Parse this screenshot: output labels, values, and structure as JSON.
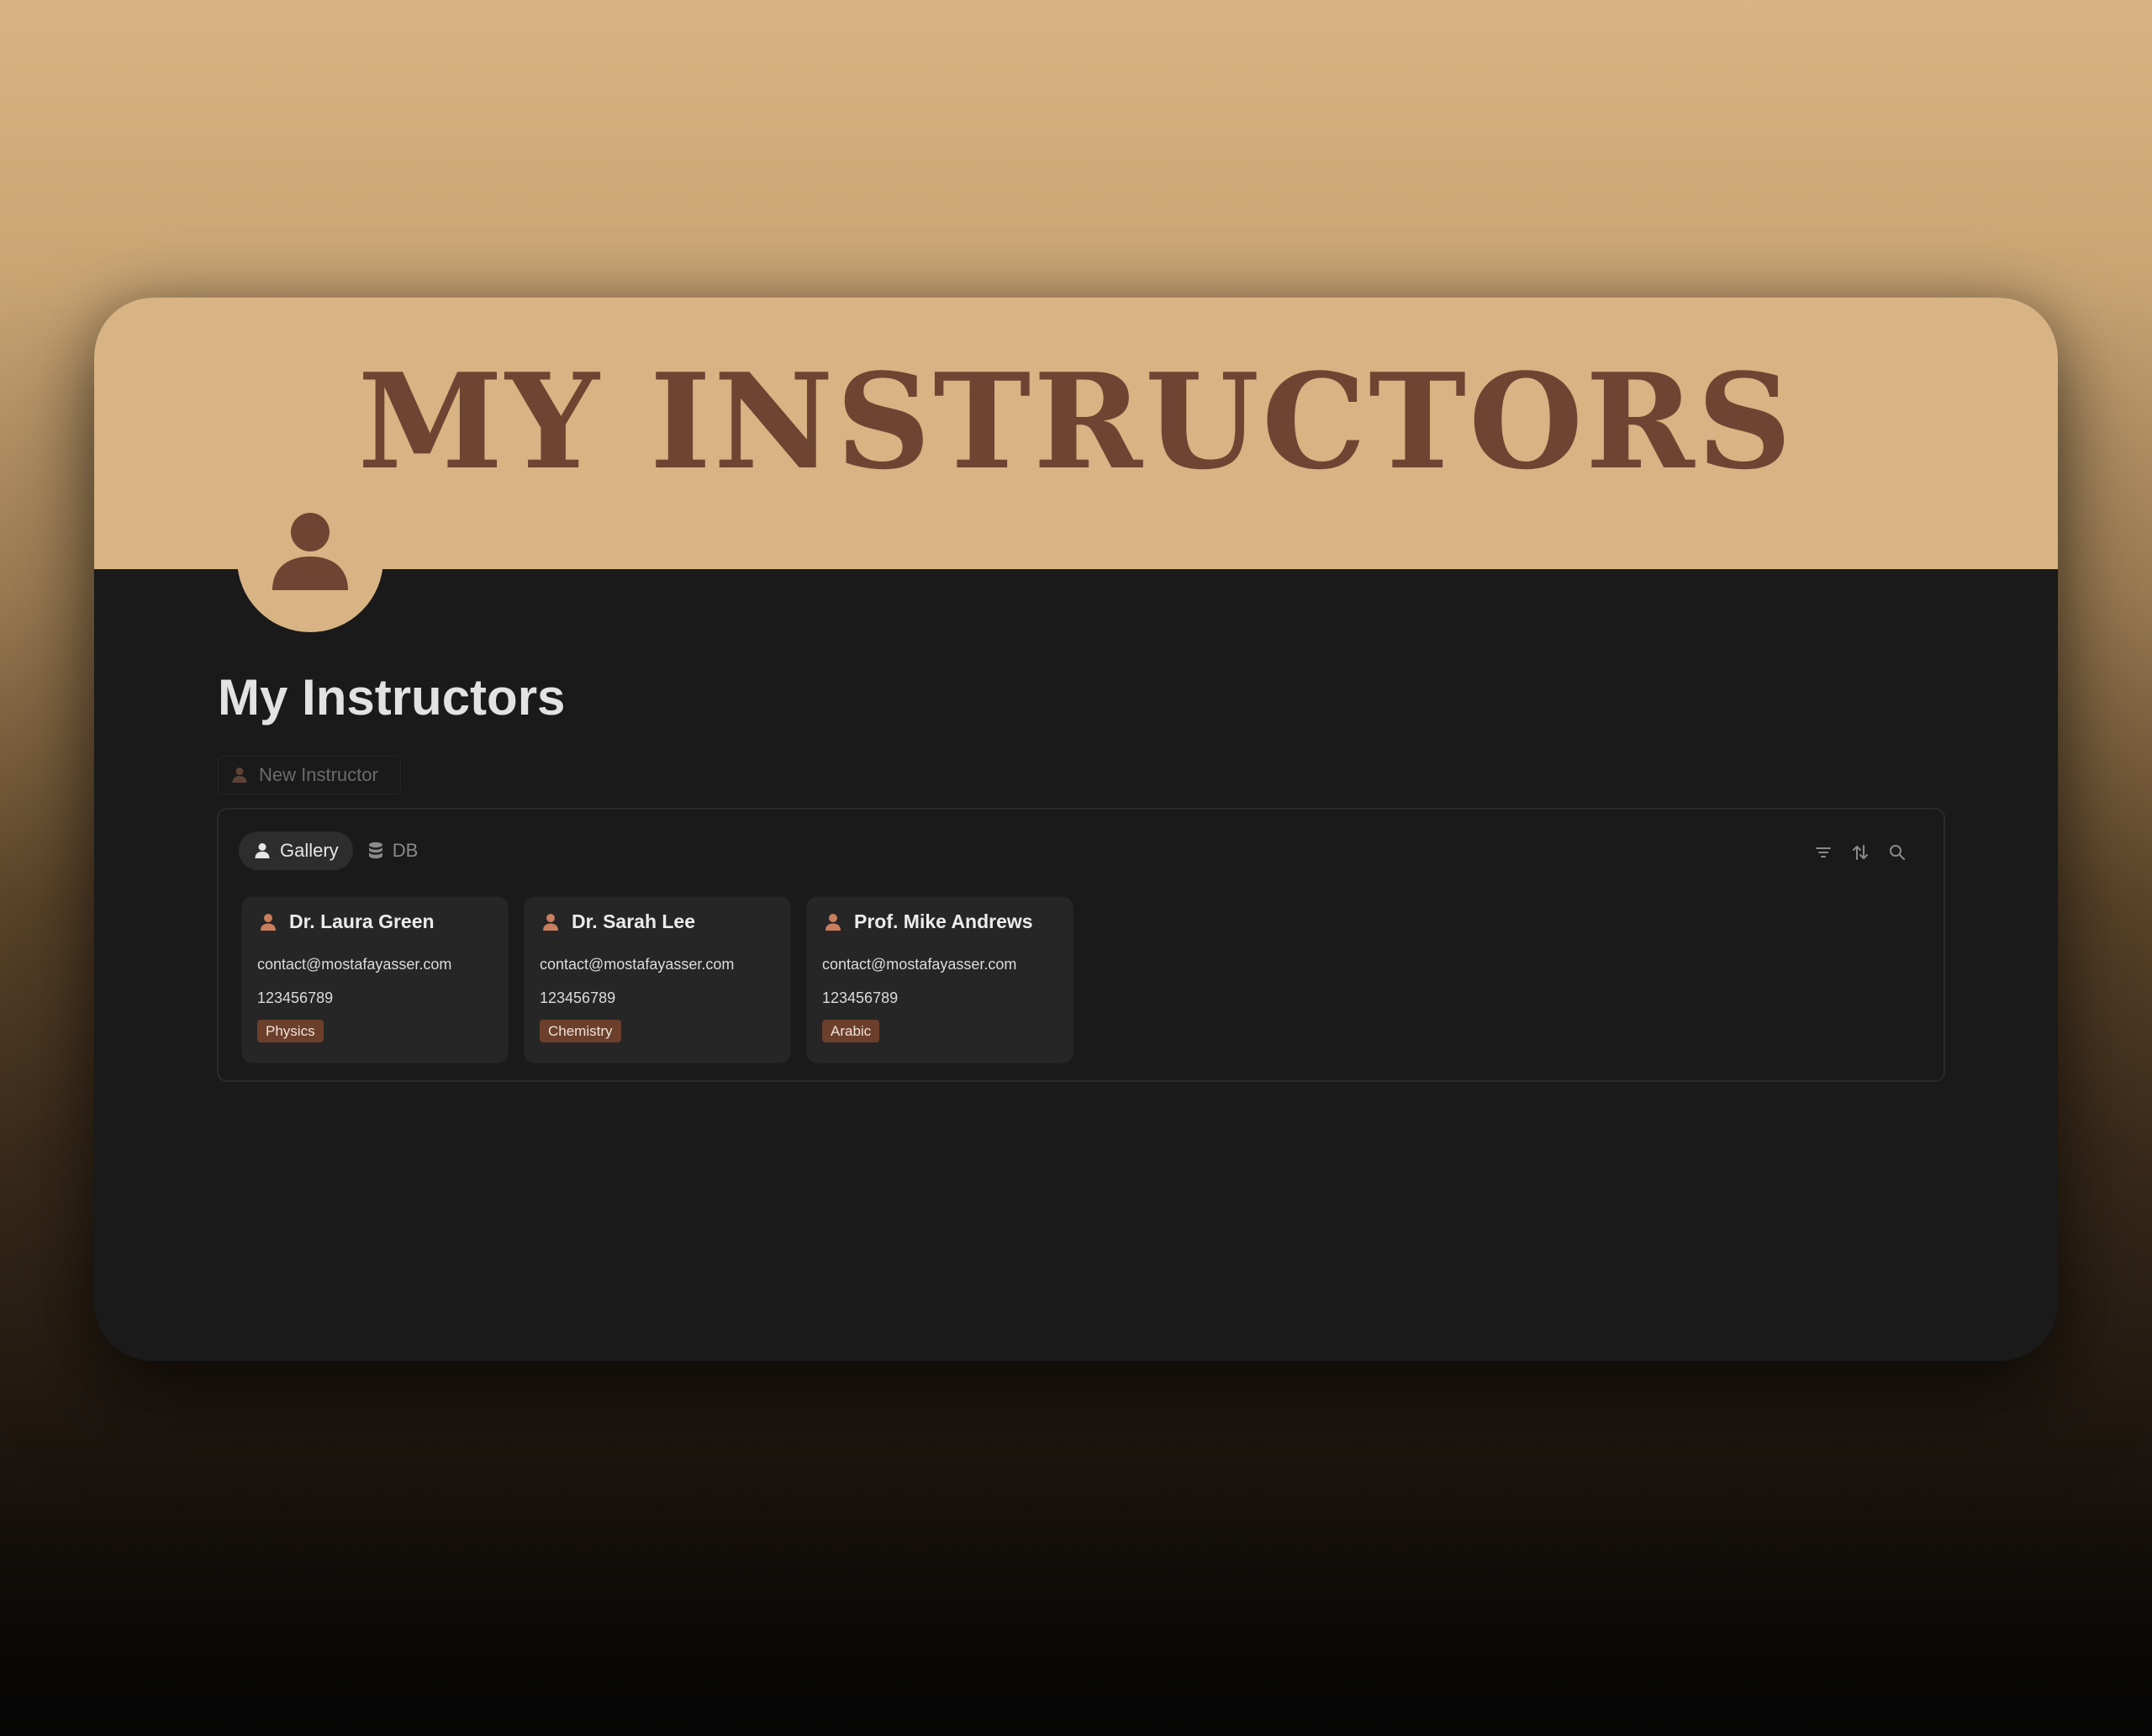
{
  "banner": {
    "title": "MY INSTRUCTORS"
  },
  "page": {
    "title": "My Instructors",
    "avatar_icon": "person-icon"
  },
  "actions": {
    "new_label": "New Instructor"
  },
  "views": {
    "tabs": [
      {
        "label": "Gallery",
        "icon": "person-icon",
        "active": true
      },
      {
        "label": "DB",
        "icon": "database-icon",
        "active": false
      }
    ],
    "tools": [
      "filter-icon",
      "sort-icon",
      "search-icon"
    ]
  },
  "instructors": [
    {
      "name": "Dr. Laura Green",
      "email": "contact@mostafayasser.com",
      "phone": "123456789",
      "subject": "Physics"
    },
    {
      "name": "Dr. Sarah Lee",
      "email": "contact@mostafayasser.com",
      "phone": "123456789",
      "subject": "Chemistry"
    },
    {
      "name": "Prof. Mike Andrews",
      "email": "contact@mostafayasser.com",
      "phone": "123456789",
      "subject": "Arabic"
    }
  ],
  "colors": {
    "accent": "#d8b383",
    "brand_brown": "#6d4532",
    "tag_bg": "#6b3f2c",
    "icon_orange": "#c97e5d",
    "background": "#1a1a1a"
  }
}
